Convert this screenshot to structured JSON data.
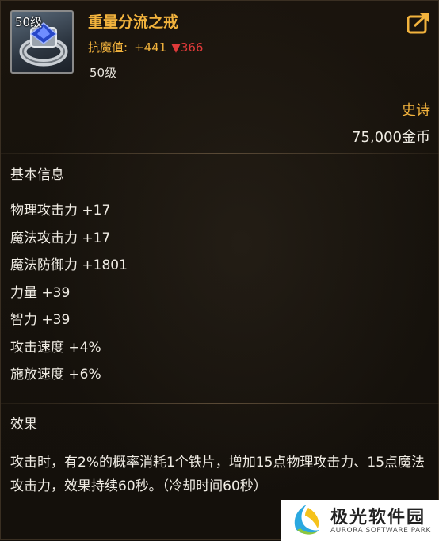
{
  "item": {
    "icon_name": "ring-icon",
    "icon_level": "50级",
    "name": "重量分流之戒",
    "stat_label": "抗魔值:",
    "stat_plus": "+441",
    "stat_down_arrow": "▼",
    "stat_down_value": "366",
    "level_text": "50级",
    "rarity": "史诗",
    "price": "75,000金币"
  },
  "basic_info": {
    "title": "基本信息",
    "stats": [
      "物理攻击力 +17",
      "魔法攻击力 +17",
      "魔法防御力 +1801",
      "力量 +39",
      "智力 +39",
      "攻击速度 +4%",
      "施放速度 +6%"
    ]
  },
  "effect": {
    "title": "效果",
    "text": "攻击时，有2%的概率消耗1个铁片，增加15点物理攻击力、15点魔法攻击力，效果持续60秒。（冷却时间60秒）"
  },
  "watermark": {
    "name": "极光软件园",
    "subtitle": "AURORA SOFTWARE PARK"
  },
  "colors": {
    "gold": "#f2b33d",
    "down_red": "#e03a3a",
    "text": "#f0ece4",
    "background": "#16120c"
  }
}
